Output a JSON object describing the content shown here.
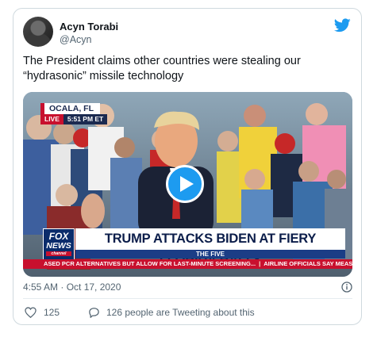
{
  "author": {
    "name": "Acyn Torabi",
    "handle": "@Acyn"
  },
  "tweet": {
    "text": "The President claims other countries were stealing our “hydrasonic” missile technology",
    "timestamp": "4:55 AM · Oct 17, 2020"
  },
  "video": {
    "location": "OCALA, FL",
    "live_label": "LIVE",
    "live_time": "5:51 PM ET",
    "network_logo_top": "FOX",
    "network_logo_bottom": "NEWS",
    "network_logo_channel": "channel",
    "headline": "TRUMP ATTACKS BIDEN AT FIERY FLORIDA RALLY",
    "show_name": "THE FIVE",
    "ticker_left": "ASED PCR ALTERNATIVES BUT ALLOW FOR LAST-MINUTE SCREENING...",
    "ticker_right": "AIRLINE OFFICIALS SAY MEASURES"
  },
  "engagement": {
    "likes": "125",
    "tweeting": "126 people are Tweeting about this"
  },
  "colors": {
    "twitter_blue": "#1d9bf0",
    "fox_red": "#c8102e",
    "fox_navy": "#0b2c6b"
  },
  "icons": {
    "brand": "twitter-bird-icon",
    "play": "play-icon",
    "info": "info-icon",
    "like": "heart-icon",
    "reply": "speech-bubble-icon"
  }
}
